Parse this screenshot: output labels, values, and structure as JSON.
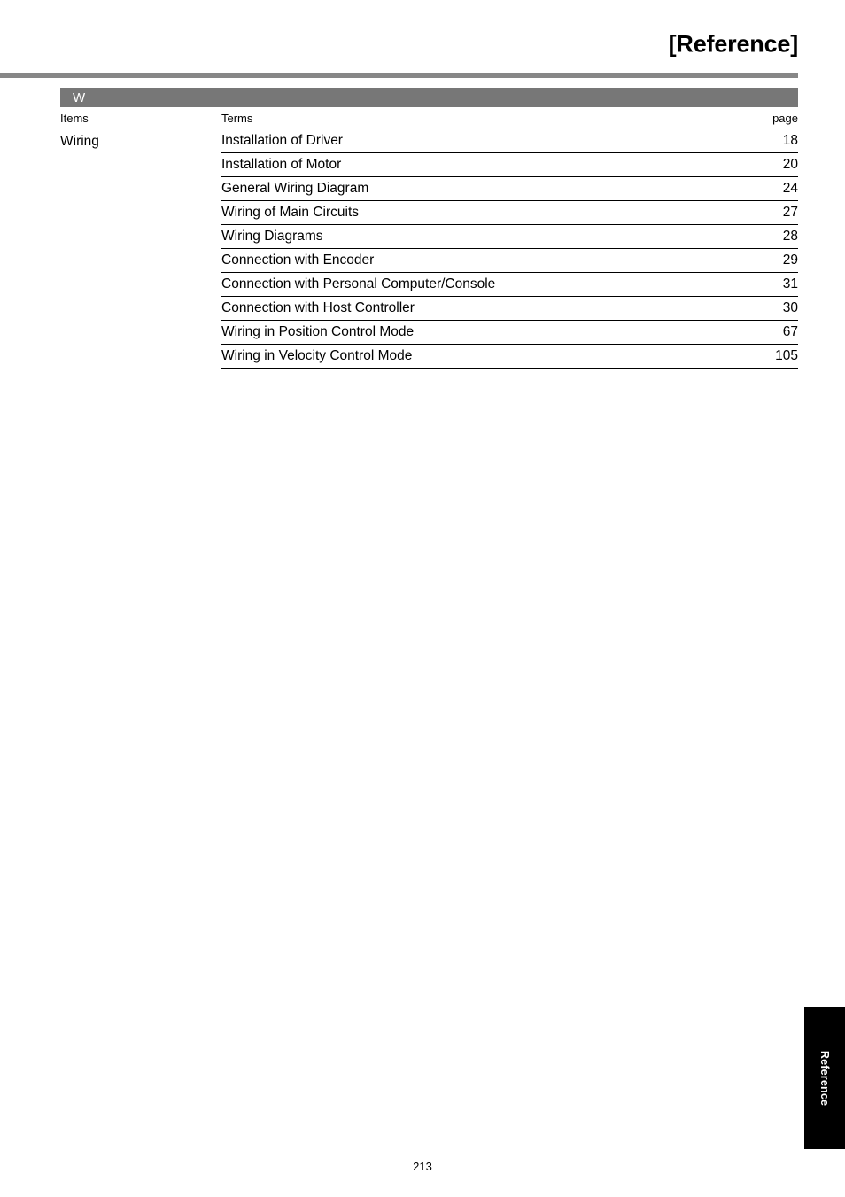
{
  "header": {
    "title": "[Reference]"
  },
  "index": {
    "section_letter": "W",
    "columns": {
      "items": "Items",
      "terms": "Terms",
      "page": "page"
    },
    "group_label": "Wiring",
    "rows": [
      {
        "term": "Installation of Driver",
        "page": "18"
      },
      {
        "term": "Installation of Motor",
        "page": "20"
      },
      {
        "term": "General Wiring Diagram",
        "page": "24"
      },
      {
        "term": "Wiring of Main Circuits",
        "page": "27"
      },
      {
        "term": "Wiring Diagrams",
        "page": "28"
      },
      {
        "term": "Connection with Encoder",
        "page": "29"
      },
      {
        "term": "Connection with Personal Computer/Console",
        "page": "31"
      },
      {
        "term": "Connection with Host Controller",
        "page": "30"
      },
      {
        "term": "Wiring in Position Control Mode",
        "page": "67"
      },
      {
        "term": "Wiring in Velocity Control Mode",
        "page": "105"
      }
    ]
  },
  "side_tab": {
    "label": "Reference"
  },
  "footer": {
    "page_number": "213"
  },
  "colors": {
    "rule_gray": "#878787",
    "section_bar_gray": "#777777",
    "tab_black": "#000000",
    "text": "#000000"
  }
}
